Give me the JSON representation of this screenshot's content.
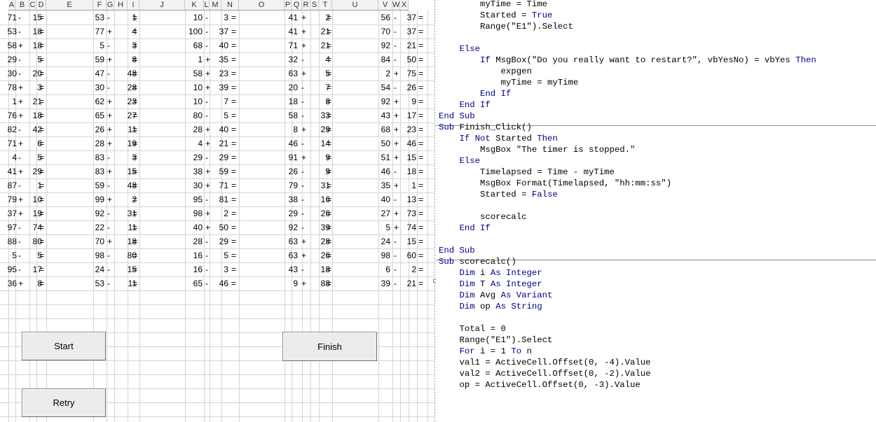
{
  "column_headers": [
    "A",
    "B",
    "C",
    "D",
    "E",
    "F",
    "G",
    "H",
    "I",
    "J",
    "K",
    "L",
    "M",
    "N",
    "O",
    "P",
    "Q",
    "R",
    "S",
    "T",
    "U",
    "V",
    "W",
    "X"
  ],
  "groups": [
    {
      "rows": [
        [
          "71",
          "-",
          "15",
          "="
        ],
        [
          "53",
          "-",
          "18",
          "="
        ],
        [
          "58",
          "+",
          "18",
          "="
        ],
        [
          "29",
          "-",
          "5",
          "="
        ],
        [
          "30",
          "-",
          "20",
          "="
        ],
        [
          "78",
          "+",
          "3",
          "="
        ],
        [
          "1",
          "+",
          "21",
          "="
        ],
        [
          "76",
          "+",
          "18",
          "="
        ],
        [
          "82",
          "-",
          "42",
          "="
        ],
        [
          "71",
          "+",
          "6",
          "="
        ],
        [
          "4",
          "-",
          "5",
          "="
        ],
        [
          "41",
          "+",
          "29",
          "="
        ],
        [
          "87",
          "-",
          "1",
          "="
        ],
        [
          "79",
          "+",
          "10",
          "="
        ],
        [
          "37",
          "+",
          "19",
          "="
        ],
        [
          "97",
          "-",
          "74",
          "="
        ],
        [
          "88",
          "-",
          "80",
          "="
        ],
        [
          "5",
          "-",
          "5",
          "="
        ],
        [
          "95",
          "-",
          "17",
          "="
        ],
        [
          "36",
          "+",
          "8",
          "="
        ]
      ]
    },
    {
      "rows": [
        [
          "53",
          "-",
          "1",
          "="
        ],
        [
          "77",
          "+",
          "4",
          "="
        ],
        [
          "5",
          "-",
          "3",
          "="
        ],
        [
          "59",
          "+",
          "8",
          "="
        ],
        [
          "47",
          "-",
          "48",
          "="
        ],
        [
          "30",
          "-",
          "28",
          "="
        ],
        [
          "62",
          "+",
          "23",
          "="
        ],
        [
          "65",
          "+",
          "27",
          "="
        ],
        [
          "26",
          "+",
          "11",
          "="
        ],
        [
          "28",
          "+",
          "19",
          "="
        ],
        [
          "83",
          "-",
          "3",
          "="
        ],
        [
          "83",
          "+",
          "15",
          "="
        ],
        [
          "59",
          "-",
          "48",
          "="
        ],
        [
          "99",
          "+",
          "2",
          "="
        ],
        [
          "92",
          "-",
          "31",
          "="
        ],
        [
          "22",
          "-",
          "11",
          "="
        ],
        [
          "70",
          "+",
          "18",
          "="
        ],
        [
          "98",
          "-",
          "80",
          "="
        ],
        [
          "24",
          "-",
          "15",
          "="
        ],
        [
          "53",
          "-",
          "11",
          "="
        ]
      ]
    },
    {
      "rows": [
        [
          "10",
          "-",
          "3",
          "="
        ],
        [
          "100",
          "-",
          "37",
          "="
        ],
        [
          "68",
          "-",
          "40",
          "="
        ],
        [
          "1",
          "+",
          "35",
          "="
        ],
        [
          "58",
          "+",
          "23",
          "="
        ],
        [
          "10",
          "+",
          "39",
          "="
        ],
        [
          "10",
          "-",
          "7",
          "="
        ],
        [
          "80",
          "-",
          "5",
          "="
        ],
        [
          "28",
          "+",
          "40",
          "="
        ],
        [
          "4",
          "+",
          "21",
          "="
        ],
        [
          "29",
          "-",
          "29",
          "="
        ],
        [
          "38",
          "+",
          "59",
          "="
        ],
        [
          "30",
          "+",
          "71",
          "="
        ],
        [
          "95",
          "-",
          "81",
          "="
        ],
        [
          "98",
          "+",
          "2",
          "="
        ],
        [
          "40",
          "+",
          "50",
          "="
        ],
        [
          "28",
          "-",
          "29",
          "="
        ],
        [
          "16",
          "-",
          "5",
          "="
        ],
        [
          "16",
          "-",
          "3",
          "="
        ],
        [
          "65",
          "-",
          "46",
          "="
        ]
      ]
    },
    {
      "rows": [
        [
          "41",
          "+",
          "2",
          "="
        ],
        [
          "41",
          "+",
          "21",
          "="
        ],
        [
          "71",
          "+",
          "21",
          "="
        ],
        [
          "32",
          "-",
          "4",
          "="
        ],
        [
          "63",
          "+",
          "5",
          "="
        ],
        [
          "20",
          "-",
          "7",
          "="
        ],
        [
          "18",
          "-",
          "8",
          "="
        ],
        [
          "58",
          "-",
          "33",
          "="
        ],
        [
          "8",
          "+",
          "29",
          "="
        ],
        [
          "46",
          "-",
          "14",
          "="
        ],
        [
          "91",
          "+",
          "9",
          "="
        ],
        [
          "26",
          "-",
          "9",
          "="
        ],
        [
          "79",
          "-",
          "31",
          "="
        ],
        [
          "38",
          "-",
          "16",
          "="
        ],
        [
          "29",
          "-",
          "26",
          "="
        ],
        [
          "92",
          "-",
          "39",
          "="
        ],
        [
          "63",
          "+",
          "28",
          "="
        ],
        [
          "63",
          "+",
          "26",
          "="
        ],
        [
          "43",
          "-",
          "18",
          "="
        ],
        [
          "9",
          "+",
          "88",
          "="
        ]
      ]
    },
    {
      "rows": [
        [
          "56",
          "-",
          "37",
          "="
        ],
        [
          "70",
          "-",
          "37",
          "="
        ],
        [
          "92",
          "-",
          "21",
          "="
        ],
        [
          "84",
          "-",
          "50",
          "="
        ],
        [
          "2",
          "+",
          "75",
          "="
        ],
        [
          "54",
          "-",
          "26",
          "="
        ],
        [
          "92",
          "+",
          "9",
          "="
        ],
        [
          "43",
          "+",
          "17",
          "="
        ],
        [
          "68",
          "+",
          "23",
          "="
        ],
        [
          "50",
          "+",
          "46",
          "="
        ],
        [
          "51",
          "+",
          "15",
          "="
        ],
        [
          "46",
          "-",
          "18",
          "="
        ],
        [
          "35",
          "+",
          "1",
          "="
        ],
        [
          "40",
          "-",
          "13",
          "="
        ],
        [
          "27",
          "+",
          "73",
          "="
        ],
        [
          "5",
          "+",
          "74",
          "="
        ],
        [
          "24",
          "-",
          "15",
          "="
        ],
        [
          "98",
          "-",
          "60",
          "="
        ],
        [
          "6",
          "-",
          "2",
          "="
        ],
        [
          "39",
          "-",
          "21",
          "="
        ]
      ]
    }
  ],
  "buttons": {
    "start": "Start",
    "finish": "Finish",
    "retry": "Retry"
  },
  "code_lines": [
    {
      "text": "        myTime = Time"
    },
    {
      "text": "        Started = True",
      "parts": [
        {
          "t": "        Started = "
        },
        {
          "t": "True",
          "k": 1
        }
      ]
    },
    {
      "text": "        Range(\"E1\").Select"
    },
    {
      "text": ""
    },
    {
      "text": "    Else",
      "parts": [
        {
          "t": "    "
        },
        {
          "t": "Else",
          "k": 1
        }
      ]
    },
    {
      "text": "        If MsgBox(\"Do you really want to restart?\", vbYesNo) = vbYes Then",
      "parts": [
        {
          "t": "        "
        },
        {
          "t": "If",
          "k": 1
        },
        {
          "t": " MsgBox(\"Do you really want to restart?\", vbYesNo) = vbYes "
        },
        {
          "t": "Then",
          "k": 1
        }
      ]
    },
    {
      "text": "            expgen"
    },
    {
      "text": "            myTime = myTime"
    },
    {
      "text": "        End If",
      "parts": [
        {
          "t": "        "
        },
        {
          "t": "End If",
          "k": 1
        }
      ]
    },
    {
      "text": "    End If",
      "parts": [
        {
          "t": "    "
        },
        {
          "t": "End If",
          "k": 1
        }
      ]
    },
    {
      "text": "End Sub",
      "parts": [
        {
          "t": "End Sub",
          "k": 1
        }
      ]
    },
    {
      "sep": true
    },
    {
      "text": "Sub Finish_Click()",
      "parts": [
        {
          "t": "Sub",
          "k": 1
        },
        {
          "t": " Finish_Click()"
        }
      ]
    },
    {
      "text": "    If Not Started Then",
      "parts": [
        {
          "t": "    "
        },
        {
          "t": "If Not",
          "k": 1
        },
        {
          "t": " Started "
        },
        {
          "t": "Then",
          "k": 1
        }
      ]
    },
    {
      "text": "        MsgBox \"The timer is stopped.\""
    },
    {
      "text": "    Else",
      "parts": [
        {
          "t": "    "
        },
        {
          "t": "Else",
          "k": 1
        }
      ]
    },
    {
      "text": "        Timelapsed = Time - myTime"
    },
    {
      "text": "        MsgBox Format(Timelapsed, \"hh:mm:ss\")"
    },
    {
      "text": "        Started = False",
      "parts": [
        {
          "t": "        Started = "
        },
        {
          "t": "False",
          "k": 1
        }
      ]
    },
    {
      "text": ""
    },
    {
      "text": "        scorecalc"
    },
    {
      "text": "    End If",
      "parts": [
        {
          "t": "    "
        },
        {
          "t": "End If",
          "k": 1
        }
      ]
    },
    {
      "text": ""
    },
    {
      "text": "End Sub",
      "parts": [
        {
          "t": "End Sub",
          "k": 1
        }
      ]
    },
    {
      "sep": true
    },
    {
      "text": "Sub scorecalc()",
      "parts": [
        {
          "t": "Sub",
          "k": 1
        },
        {
          "t": " scorecalc()"
        }
      ]
    },
    {
      "text": "    Dim i As Integer",
      "parts": [
        {
          "t": "    "
        },
        {
          "t": "Dim",
          "k": 1
        },
        {
          "t": " i "
        },
        {
          "t": "As Integer",
          "k": 1
        }
      ]
    },
    {
      "text": "    Dim T As Integer",
      "parts": [
        {
          "t": "    "
        },
        {
          "t": "Dim",
          "k": 1
        },
        {
          "t": " T "
        },
        {
          "t": "As Integer",
          "k": 1
        }
      ]
    },
    {
      "text": "    Dim Avg As Variant",
      "parts": [
        {
          "t": "    "
        },
        {
          "t": "Dim",
          "k": 1
        },
        {
          "t": " Avg "
        },
        {
          "t": "As Variant",
          "k": 1
        }
      ]
    },
    {
      "text": "    Dim op As String",
      "parts": [
        {
          "t": "    "
        },
        {
          "t": "Dim",
          "k": 1
        },
        {
          "t": " op "
        },
        {
          "t": "As String",
          "k": 1
        }
      ]
    },
    {
      "text": ""
    },
    {
      "text": "    Total = 0"
    },
    {
      "text": "    Range(\"E1\").Select"
    },
    {
      "text": "    For i = 1 To n",
      "parts": [
        {
          "t": "    "
        },
        {
          "t": "For",
          "k": 1
        },
        {
          "t": " i = 1 "
        },
        {
          "t": "To",
          "k": 1
        },
        {
          "t": " n"
        }
      ]
    },
    {
      "text": "    val1 = ActiveCell.Offset(0, -4).Value"
    },
    {
      "text": "    val2 = ActiveCell.Offset(0, -2).Value"
    },
    {
      "text": "    op = ActiveCell.Offset(0, -3).Value"
    }
  ]
}
